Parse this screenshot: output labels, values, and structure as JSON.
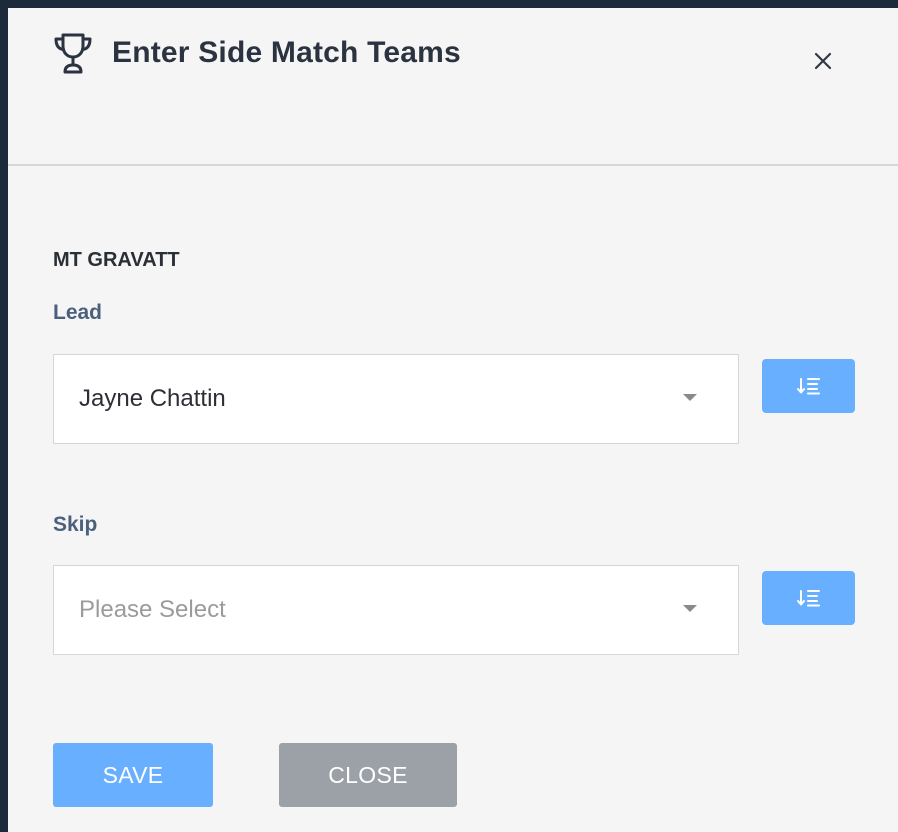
{
  "modal": {
    "title": "Enter Side Match Teams",
    "title_icon": "trophy-icon",
    "close_icon": "close-icon"
  },
  "team": {
    "name": "MT GRAVATT",
    "positions": [
      {
        "label": "Lead",
        "value": "Jayne Chattin",
        "placeholder": "",
        "sort_icon": "sort-list-icon"
      },
      {
        "label": "Skip",
        "value": "",
        "placeholder": "Please Select",
        "sort_icon": "sort-list-icon"
      }
    ]
  },
  "actions": {
    "save_label": "SAVE",
    "close_label": "CLOSE"
  },
  "colors": {
    "primary": "#69afff",
    "secondary": "#9ca1a8",
    "label": "#4b607d",
    "backdrop": "#1c2a3a"
  }
}
